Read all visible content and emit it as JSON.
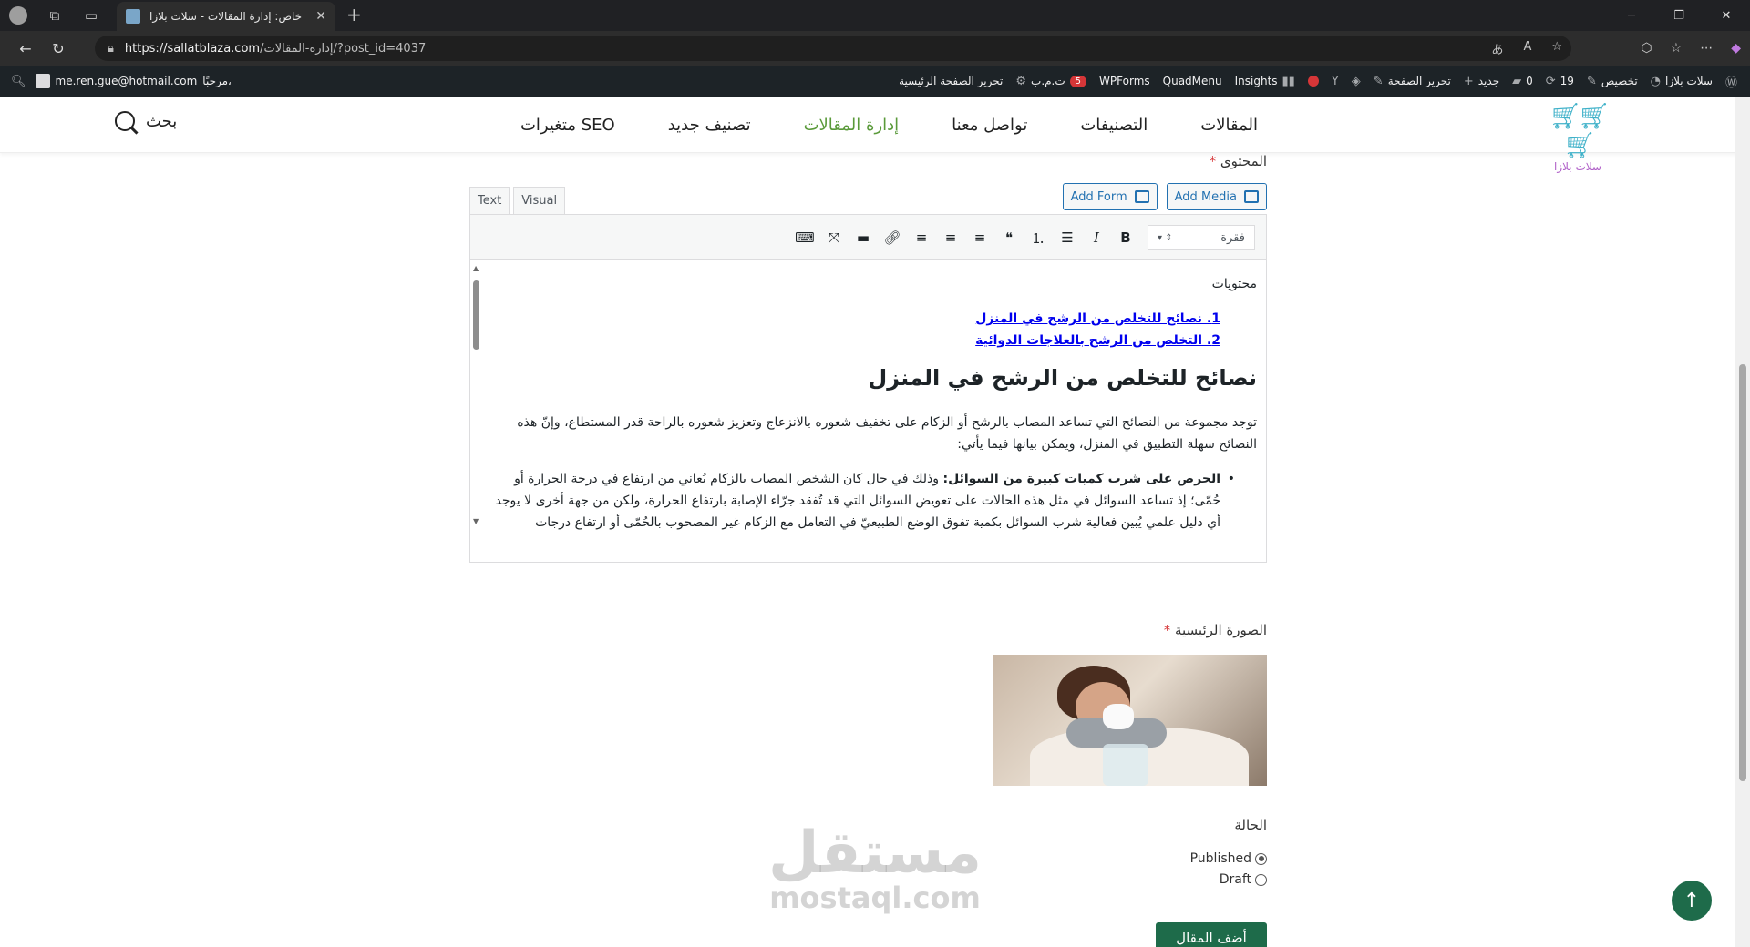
{
  "browser": {
    "tab_title": "خاص: إدارة المقالات - سلات بلازا",
    "url_domain": "https://sallatblaza.com",
    "url_path": "/إدارة-المقالات/?post_id=4037"
  },
  "wp_admin_bar": {
    "site_name": "سلات بلازا",
    "customize": "تخصيص",
    "updates_count": "19",
    "comments_count": "0",
    "new": "جديد",
    "edit_page": "تحرير الصفحة",
    "insights": "Insights",
    "quadmenu": "QuadMenu",
    "wpforms": "WPForms",
    "seo_label": "ت.م.ب",
    "seo_badge": "5",
    "edit_home": "تحرير الصفحة الرئيسية",
    "greeting": "مرحبًا،",
    "user_email": "me.ren.gue@hotmail.com"
  },
  "site_header": {
    "logo_text": "سلات بلازا",
    "nav": [
      "المقالات",
      "التصنيفات",
      "تواصل معنا",
      "إدارة المقالات",
      "تصنيف جديد",
      "متغيرات SEO"
    ],
    "active_nav_index": 3,
    "search_label": "بحث"
  },
  "form": {
    "content_label": "المحتوى",
    "required_mark": "*",
    "add_media": "Add Media",
    "add_form": "Add Form",
    "tab_visual": "Visual",
    "tab_text": "Text",
    "format_select": "فقرة",
    "editor": {
      "toc_title": "محتويات",
      "toc": [
        "1. نصائح للتخلص من الرشح في المنزل",
        "2. التخلص من الرشح بالعلاجات الدوائية"
      ],
      "heading": "نصائح للتخلص من الرشح في المنزل",
      "paragraph": "توجد مجموعة من النصائح التي تساعد المصاب بالرشح أو الزكام على تخفيف شعوره بالانزعاج وتعزيز شعوره بالراحة قدر المستطاع، وإنّ هذه النصائح سهلة التطبيق في المنزل، ويمكن بيانها فيما يأتي:",
      "bullet_bold": "الحرص على شرب كميات كبيرة من السوائل:",
      "bullet_text": " وذلك في حال كان الشخص المصاب بالزكام يُعاني من ارتفاع في درجة الحرارة أو حُمّى؛ إذ تساعد السوائل في مثل هذه الحالات على تعويض السوائل التي قد تُفقد جرّاء الإصابة بارتفاع الحرارة، ولكن من جهة أخرى لا يوجد أي دليل علمي يُبين فعالية شرب السوائل بكمية تفوق الوضع الطبيعيّ في التعامل مع الزكام غير المصحوب بالحُمّى أو ارتفاع درجات الحرارة."
    },
    "featured_image_label": "الصورة الرئيسية",
    "status_label": "الحالة",
    "status_options": [
      "Published",
      "Draft"
    ],
    "status_selected": "Published",
    "submit": "أضف المقال"
  },
  "watermark": {
    "arabic": "مستقل",
    "latin": "mostaql.com"
  },
  "icons": [
    "profile-icon",
    "workspaces-icon",
    "tab-actions-icon",
    "back-icon",
    "refresh-icon",
    "lock-icon",
    "read-aloud-icon",
    "favorite-icon",
    "extensions-icon",
    "favorites-icon",
    "more-icon",
    "wordpress-icon",
    "updates-icon",
    "comment-icon",
    "plus-icon",
    "pencil-icon",
    "yoast-icon",
    "search-icon",
    "scroll-to-top-icon"
  ],
  "colors": {
    "admin_bar": "#1d2327",
    "active_nav": "#5a9a3a",
    "button_green": "#1e6b4a",
    "link_blue": "#2271b1"
  }
}
